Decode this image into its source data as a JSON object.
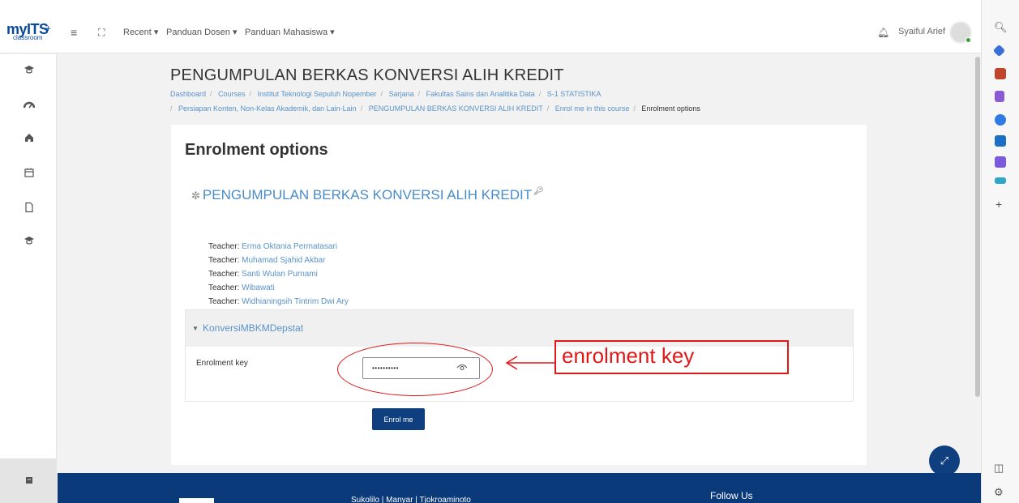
{
  "navbar": {
    "logo_main": "myITS",
    "logo_sub": "classroom",
    "logo_plus": "+",
    "menu_icon": "≡",
    "fullscreen_icon": "⛶",
    "menu_items": [
      "Recent ▾",
      "Panduan Dosen ▾",
      "Panduan Mahasiswa ▾"
    ],
    "user_name": "Syaiful Arief"
  },
  "drawer": {
    "icons": [
      "graduation-cap-icon",
      "dashboard-icon",
      "home-icon",
      "calendar-icon",
      "file-icon",
      "graduation-cap-icon",
      "archive-icon"
    ]
  },
  "page": {
    "title": "PENGUMPULAN BERKAS KONVERSI ALIH KREDIT",
    "breadcrumb": [
      "Dashboard",
      "Courses",
      "Institut Teknologi Sepuluh Nopember",
      "Sarjana",
      "Fakultas Sains dan Analitika Data",
      "S-1 STATISTIKA",
      "Persiapan Konten, Non-Kelas Akademik, dan Lain-Lain",
      "PENGUMPULAN BERKAS KONVERSI ALIH KREDIT",
      "Enrol me in this course"
    ],
    "breadcrumb_current": "Enrolment options"
  },
  "card": {
    "title": "Enrolment options",
    "course_name": "PENGUMPULAN BERKAS KONVERSI ALIH KREDIT",
    "teacher_label": "Teacher:",
    "teachers": [
      "Erma Oktania Permatasari",
      "Muhamad Sjahid Akbar",
      "Santi Wulan Purnami",
      "Wibawati",
      "Widhianingsih Tintrim Dwi Ary"
    ],
    "method_name": "KonversiMBKMDepstat",
    "field_label": "Enrolment key",
    "field_value_masked": "••••••••••",
    "button": "Enrol me"
  },
  "footer": {
    "address": "Sukolilo | Manyar | Tjokroaminoto",
    "follow": "Follow Us"
  },
  "annotation": {
    "text": "enrolment key",
    "color": "#e01818"
  }
}
